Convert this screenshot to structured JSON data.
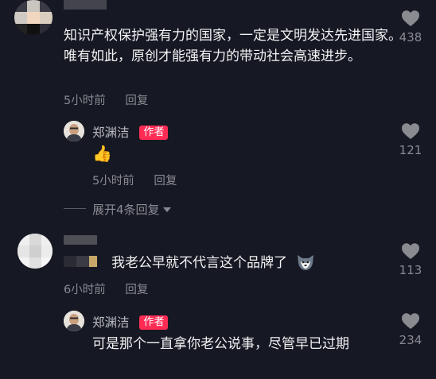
{
  "comments": [
    {
      "text": "知识产权保护强有力的国家，一定是文明发达先进国家。唯有如此，原创才能强有力的带动社会高速进步。",
      "time": "5小时前",
      "reply_label": "回复",
      "likes": "438"
    },
    {
      "username": "郑渊洁",
      "badge": "作者",
      "emoji": "👍",
      "time": "5小时前",
      "reply_label": "回复",
      "likes": "121"
    },
    {
      "text": "我老公早就不代言这个品牌了",
      "emoji": "husky-emoji",
      "time": "6小时前",
      "reply_label": "回复",
      "likes": "113"
    },
    {
      "username": "郑渊洁",
      "badge": "作者",
      "text": "可是那个一直拿你老公说事，尽管早已过期",
      "likes": "234"
    }
  ],
  "expand_replies": "展开4条回复",
  "icons": {
    "like": "heart-icon",
    "expand": "triangle-down-icon"
  },
  "colors": {
    "background": "#161823",
    "badge": "#fe2c55",
    "muted": "#8a8b91"
  }
}
